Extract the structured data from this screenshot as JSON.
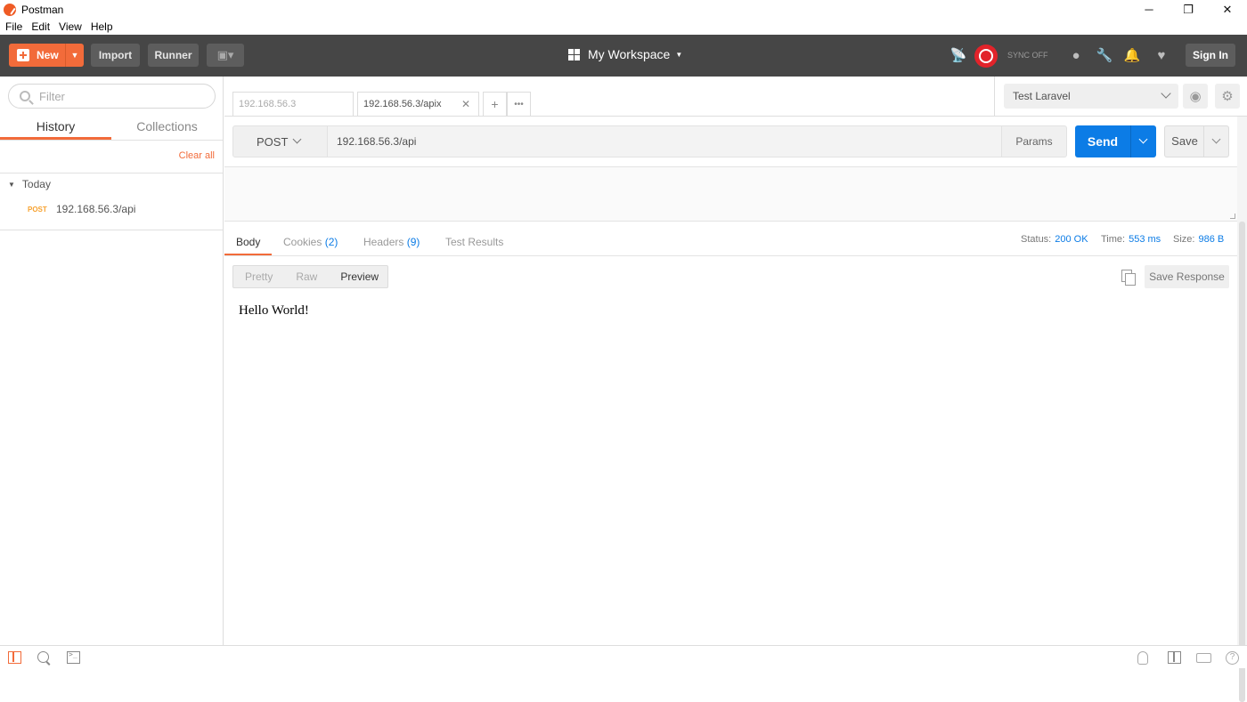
{
  "window": {
    "title": "Postman",
    "controls": {
      "minimize": "─",
      "maximize": "❐",
      "close": "✕"
    }
  },
  "menu": [
    "File",
    "Edit",
    "View",
    "Help"
  ],
  "header": {
    "new_label": "New",
    "import_label": "Import",
    "runner_label": "Runner",
    "workspace_label": "My Workspace",
    "sync_label": "SYNC OFF",
    "signin_label": "Sign In"
  },
  "sidebar": {
    "filter_placeholder": "Filter",
    "tabs": [
      "History",
      "Collections"
    ],
    "active_tab": "History",
    "clear_all": "Clear all",
    "group_label": "Today",
    "history": [
      {
        "method": "POST",
        "url": "192.168.56.3/api"
      }
    ]
  },
  "tabs": [
    {
      "label": "192.168.56.3",
      "active": false
    },
    {
      "label": "192.168.56.3/apix",
      "active": true,
      "close": "✕"
    }
  ],
  "tab_controls": {
    "add": "+",
    "more": "•••"
  },
  "environment": {
    "selected": "Test Laravel"
  },
  "request": {
    "method": "POST",
    "url": "192.168.56.3/api",
    "params_label": "Params",
    "send_label": "Send",
    "save_label": "Save"
  },
  "response": {
    "tabs": [
      {
        "label": "Body",
        "count": "",
        "active": true
      },
      {
        "label": "Cookies",
        "count": "(2)",
        "active": false
      },
      {
        "label": "Headers",
        "count": "(9)",
        "active": false
      },
      {
        "label": "Test Results",
        "count": "",
        "active": false
      }
    ],
    "status_label": "Status:",
    "status_value": "200 OK",
    "time_label": "Time:",
    "time_value": "553 ms",
    "size_label": "Size:",
    "size_value": "986 B",
    "formats": [
      "Pretty",
      "Raw",
      "Preview"
    ],
    "active_format": "Preview",
    "save_response_label": "Save Response",
    "body_text": "Hello World!"
  },
  "colors": {
    "accent": "#f26b3a",
    "send": "#0c7ce6",
    "header_bg": "#464646",
    "method_post": "#f7a230",
    "sync": "#e2232a"
  }
}
